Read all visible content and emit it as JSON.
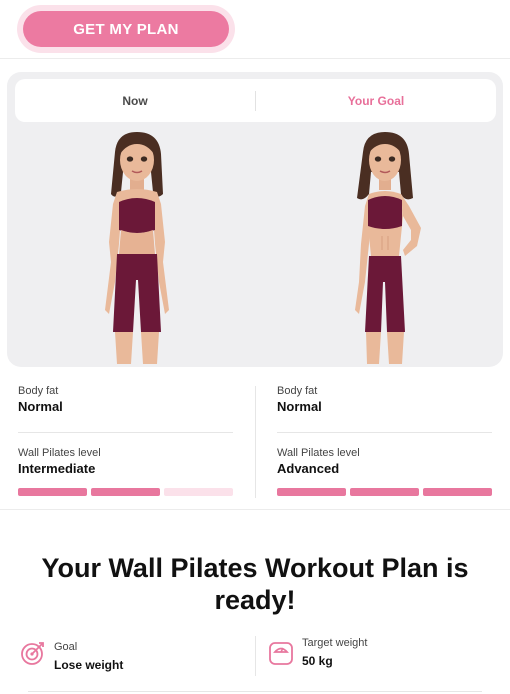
{
  "cta": {
    "label": "GET MY PLAN"
  },
  "tabs": [
    {
      "label": "Now"
    },
    {
      "label": "Your Goal"
    }
  ],
  "now": {
    "body_fat_label": "Body fat",
    "body_fat_value": "Normal",
    "level_label": "Wall Pilates level",
    "level_value": "Intermediate",
    "level_bars": 2
  },
  "goal": {
    "body_fat_label": "Body fat",
    "body_fat_value": "Normal",
    "level_label": "Wall Pilates level",
    "level_value": "Advanced",
    "level_bars": 3
  },
  "headline": "Your Wall Pilates Workout Plan is ready!",
  "goals": {
    "goal_label": "Goal",
    "goal_value": "Lose weight",
    "target_label": "Target weight",
    "target_value": "50 kg"
  },
  "colors": {
    "accent": "#e8779e",
    "accent_light": "#fbe1ea",
    "outfit": "#6b1838",
    "skin": "#e9b99a",
    "hair": "#4a2e22"
  },
  "icons": {
    "goal": "target-icon",
    "target_weight": "scale-icon"
  }
}
